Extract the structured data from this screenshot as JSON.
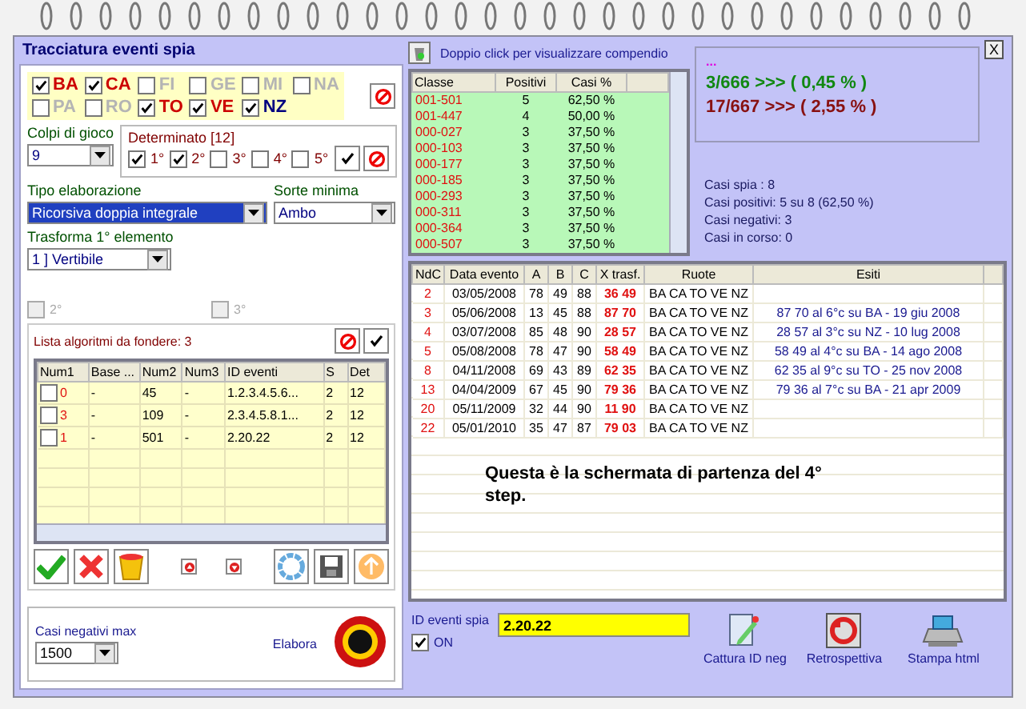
{
  "window": {
    "title": "Tracciatura eventi spia",
    "close": "X"
  },
  "wheels": [
    {
      "label": "BA",
      "checked": true,
      "color": "#cc0000"
    },
    {
      "label": "CA",
      "checked": true,
      "color": "#cc0000"
    },
    {
      "label": "FI",
      "checked": false,
      "color": "#b4b4b4"
    },
    {
      "label": "GE",
      "checked": false,
      "color": "#b4b4b4"
    },
    {
      "label": "MI",
      "checked": false,
      "color": "#b4b4b4"
    },
    {
      "label": "NA",
      "checked": false,
      "color": "#b4b4b4"
    },
    {
      "label": "PA",
      "checked": false,
      "color": "#b4b4b4"
    },
    {
      "label": "RO",
      "checked": false,
      "color": "#b4b4b4"
    },
    {
      "label": "TO",
      "checked": true,
      "color": "#cc0000"
    },
    {
      "label": "VE",
      "checked": true,
      "color": "#cc0000"
    },
    {
      "label": "NZ",
      "checked": true,
      "color": "#000080"
    }
  ],
  "colpi": {
    "label": "Colpi di gioco",
    "value": "9"
  },
  "determinato": {
    "title": "Determinato [12]",
    "options": [
      {
        "label": "1°",
        "checked": true
      },
      {
        "label": "2°",
        "checked": true
      },
      {
        "label": "3°",
        "checked": false
      },
      {
        "label": "4°",
        "checked": false
      },
      {
        "label": "5°",
        "checked": false
      }
    ]
  },
  "tipo": {
    "label": "Tipo elaborazione",
    "value": "Ricorsiva doppia integrale"
  },
  "sorte": {
    "label": "Sorte minima",
    "value": "Ambo"
  },
  "trasforma": {
    "label": "Trasforma 1° elemento",
    "value": "1 ] Vertibile"
  },
  "extra_options": [
    {
      "label": "2°",
      "checked": false,
      "disabled": true
    },
    {
      "label": "3°",
      "checked": false,
      "disabled": true
    }
  ],
  "algo_list": {
    "title": "Lista algoritmi da fondere: 3",
    "columns": [
      "Num1",
      "Base ...",
      "Num2",
      "Num3",
      "ID eventi",
      "S",
      "Det"
    ],
    "rows": [
      {
        "checked": false,
        "cells": [
          "0",
          "-",
          "45",
          "-",
          "1.2.3.4.5.6...",
          "2",
          "12"
        ]
      },
      {
        "checked": false,
        "cells": [
          "3",
          "-",
          "109",
          "-",
          "2.3.4.5.8.1...",
          "2",
          "12"
        ]
      },
      {
        "checked": false,
        "cells": [
          "1",
          "-",
          "501",
          "-",
          "2.20.22",
          "2",
          "12"
        ]
      }
    ]
  },
  "casi_negativi": {
    "label": "Casi negativi max",
    "value": "1500"
  },
  "elabora": {
    "label": "Elabora"
  },
  "compendio": {
    "hint": "Doppio click per visualizzare compendio",
    "columns": [
      "Classe",
      "Positivi",
      "Casi %"
    ],
    "rows": [
      [
        "001-501",
        "5",
        "62,50 %"
      ],
      [
        "001-447",
        "4",
        "50,00 %"
      ],
      [
        "000-027",
        "3",
        "37,50 %"
      ],
      [
        "000-103",
        "3",
        "37,50 %"
      ],
      [
        "000-177",
        "3",
        "37,50 %"
      ],
      [
        "000-185",
        "3",
        "37,50 %"
      ],
      [
        "000-293",
        "3",
        "37,50 %"
      ],
      [
        "000-311",
        "3",
        "37,50 %"
      ],
      [
        "000-364",
        "3",
        "37,50 %"
      ],
      [
        "000-507",
        "3",
        "37,50 %"
      ]
    ]
  },
  "summary": {
    "dots": "...",
    "lines": [
      {
        "text": "3/666 >>> ( 0,45 % )",
        "color": "#118811"
      },
      {
        "text": "17/667 >>> ( 2,55 % )",
        "color": "#881111"
      }
    ]
  },
  "stats": [
    "Casi spia : 8",
    "Casi positivi: 5 su 8 (62,50 %)",
    "Casi negativi: 3",
    "Casi in corso: 0"
  ],
  "events": {
    "columns": [
      "NdC",
      "Data evento",
      "A",
      "B",
      "C",
      "X trasf.",
      "Ruote",
      "Esiti"
    ],
    "rows": [
      [
        "2",
        "03/05/2008",
        "78",
        "49",
        "88",
        "36 49",
        "BA CA TO VE NZ",
        ""
      ],
      [
        "3",
        "05/06/2008",
        "13",
        "45",
        "88",
        "87 70",
        "BA CA TO VE NZ",
        "87 70 al 6°c su BA - 19 giu 2008"
      ],
      [
        "4",
        "03/07/2008",
        "85",
        "48",
        "90",
        "28 57",
        "BA CA TO VE NZ",
        "28 57 al 3°c su NZ - 10 lug 2008"
      ],
      [
        "5",
        "05/08/2008",
        "78",
        "47",
        "90",
        "58 49",
        "BA CA TO VE NZ",
        "58 49 al 4°c su BA - 14 ago 2008"
      ],
      [
        "8",
        "04/11/2008",
        "69",
        "43",
        "89",
        "62 35",
        "BA CA TO VE NZ",
        "62 35 al 9°c su TO - 25 nov 2008"
      ],
      [
        "13",
        "04/04/2009",
        "67",
        "45",
        "90",
        "79 36",
        "BA CA TO VE NZ",
        "79 36 al 7°c su BA - 21 apr 2009"
      ],
      [
        "20",
        "05/11/2009",
        "32",
        "44",
        "90",
        "11 90",
        "BA CA TO VE NZ",
        ""
      ],
      [
        "22",
        "05/01/2010",
        "35",
        "47",
        "87",
        "79 03",
        "BA CA TO VE NZ",
        ""
      ]
    ]
  },
  "note": "Questa è la schermata di partenza del 4° step.",
  "id_eventi": {
    "label": "ID eventi spia",
    "value": "2.20.22",
    "on_label": "ON",
    "on": true
  },
  "actions": [
    {
      "label": "Cattura ID neg",
      "kind": "capture"
    },
    {
      "label": "Retrospettiva",
      "kind": "retro"
    },
    {
      "label": "Stampa html",
      "kind": "print"
    }
  ]
}
